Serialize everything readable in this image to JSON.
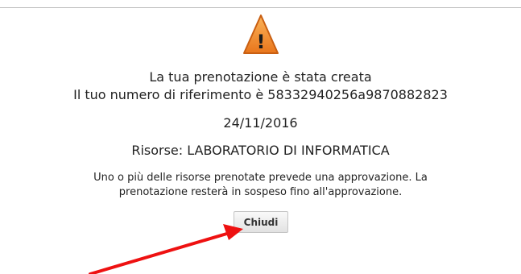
{
  "dialog": {
    "icon": "warning-icon",
    "icon_mark": "!",
    "created_message": "La tua prenotazione è stata creata",
    "reference_message": "Il tuo numero di riferimento è 58332940256a9870882823",
    "date": "24/11/2016",
    "resources": "Risorse: LABORATORIO DI INFORMATICA",
    "approval_line_1": "Uno o più delle risorse prenotate prevede una approvazione. La",
    "approval_line_2": "prenotazione resterà in sospeso fino all'approvazione.",
    "close_label": "Chiudi"
  },
  "colors": {
    "warning_orange": "#f28c28",
    "annotation_red": "#ee1111"
  }
}
